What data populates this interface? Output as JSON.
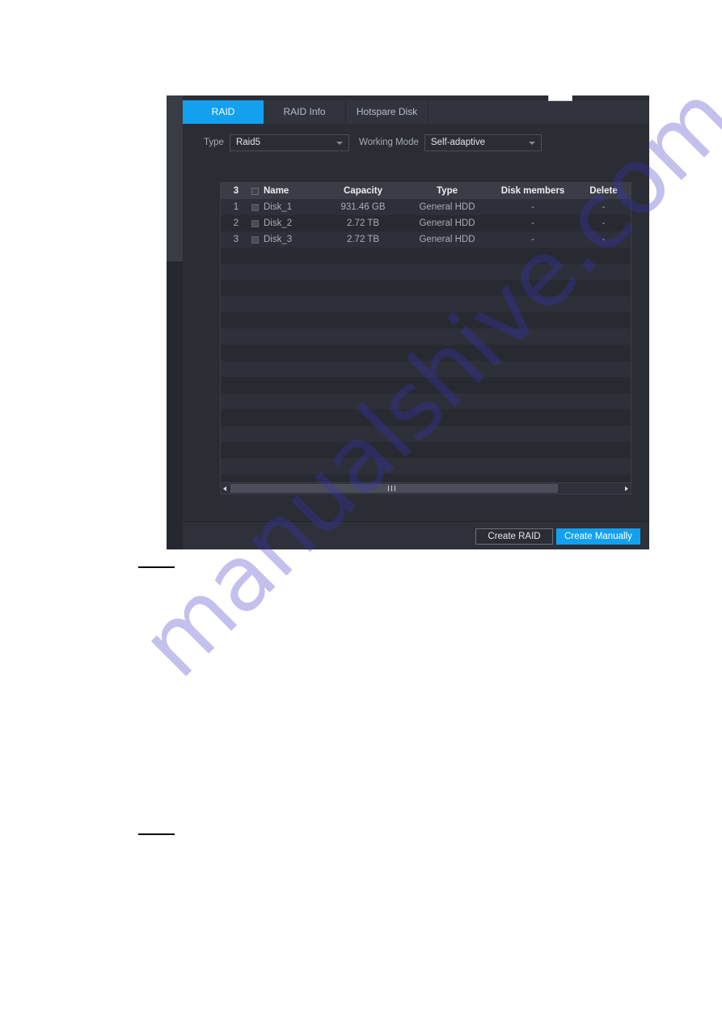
{
  "dialog": {
    "tabs": [
      {
        "label": "RAID",
        "active": true
      },
      {
        "label": "RAID Info",
        "active": false
      },
      {
        "label": "Hotspare Disk",
        "active": false
      }
    ],
    "controls": {
      "type_label": "Type",
      "type_value": "Raid5",
      "working_mode_label": "Working Mode",
      "working_mode_value": "Self-adaptive"
    },
    "table": {
      "headers": {
        "count": "3",
        "name": "Name",
        "capacity": "Capacity",
        "type": "Type",
        "disk_members": "Disk members",
        "delete": "Delete"
      },
      "rows": [
        {
          "index": "1",
          "name": "Disk_1",
          "capacity": "931.46 GB",
          "type": "General HDD",
          "disk_members": "-",
          "delete": "-"
        },
        {
          "index": "2",
          "name": "Disk_2",
          "capacity": "2.72 TB",
          "type": "General HDD",
          "disk_members": "-",
          "delete": "-"
        },
        {
          "index": "3",
          "name": "Disk_3",
          "capacity": "2.72 TB",
          "type": "General HDD",
          "disk_members": "-",
          "delete": "-"
        }
      ]
    },
    "footer": {
      "create_raid_label": "Create RAID",
      "create_manually_label": "Create Manually"
    }
  },
  "page": {
    "watermark": "manualshive.com"
  },
  "colors": {
    "accent": "#13a0ef",
    "window_bg": "#2b2d35",
    "header_row": "#3a3d46",
    "watermark": "#3b33c8"
  }
}
